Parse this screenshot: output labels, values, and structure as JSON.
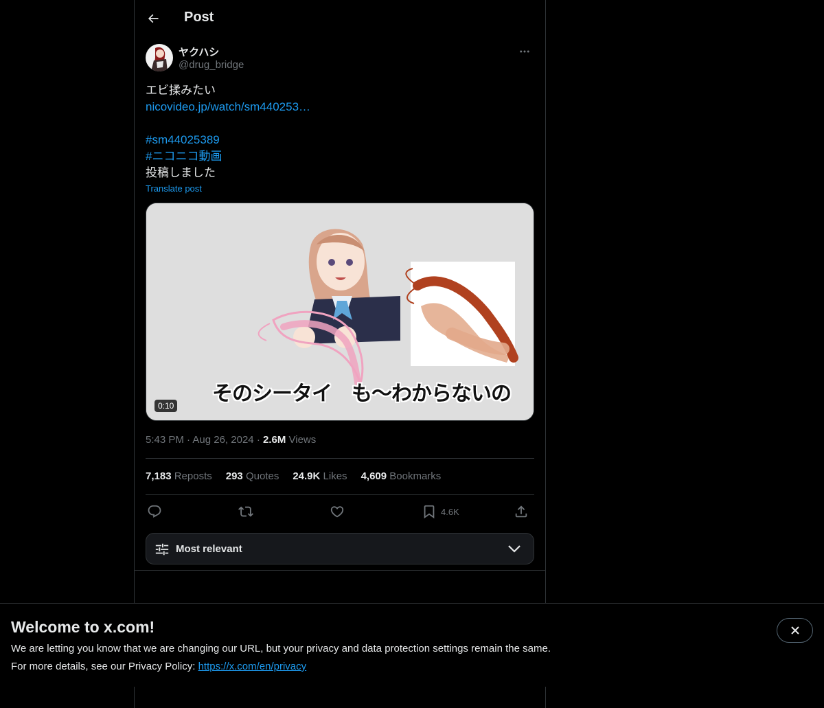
{
  "header": {
    "title": "Post"
  },
  "author": {
    "display_name": "ヤクハシ",
    "handle": "@drug_bridge"
  },
  "post": {
    "lines": [
      {
        "text": "エビ揉みたい",
        "kind": "text"
      },
      {
        "text": "nicovideo.jp/watch/sm440253…",
        "kind": "link"
      },
      {
        "text": "",
        "kind": "blank"
      },
      {
        "text": "#sm44025389",
        "kind": "link"
      },
      {
        "text": "#ニコニコ動画",
        "kind": "link"
      },
      {
        "text": "投稿しました",
        "kind": "text"
      }
    ],
    "translate_label": "Translate post"
  },
  "media": {
    "duration": "0:10",
    "caption": "そのシータイ　も～わからないの"
  },
  "meta": {
    "time": "5:43 PM",
    "date": "Aug 26, 2024",
    "views_count": "2.6M",
    "views_label": "Views"
  },
  "stats": {
    "reposts_count": "7,183",
    "reposts_label": "Reposts",
    "quotes_count": "293",
    "quotes_label": "Quotes",
    "likes_count": "24.9K",
    "likes_label": "Likes",
    "bookmarks_count": "4,609",
    "bookmarks_label": "Bookmarks"
  },
  "actions": {
    "bookmark_count": "4.6K"
  },
  "sort": {
    "label": "Most relevant"
  },
  "banner": {
    "title": "Welcome to x.com!",
    "line1": "We are letting you know that we are changing our URL, but your privacy and data protection settings remain the same.",
    "line2_prefix": "For more details, see our Privacy Policy: ",
    "link": "https://x.com/en/privacy"
  },
  "colors": {
    "accent": "#1d9bf0",
    "background": "#000000",
    "text": "#e7e9ea",
    "muted": "#71767b",
    "border": "#2f3336"
  }
}
